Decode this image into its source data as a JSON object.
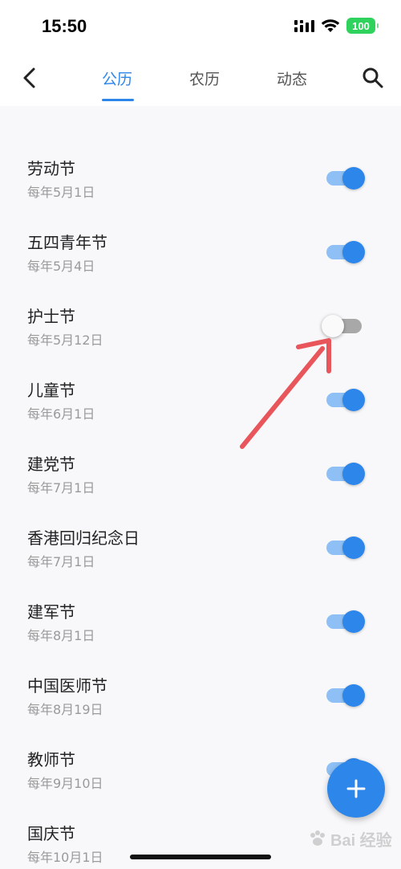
{
  "status_bar": {
    "time": "15:50",
    "battery": "100",
    "battery_color": "#2fd25c"
  },
  "nav": {
    "back_icon": "chevron-left-icon",
    "tabs": [
      {
        "label": "公历",
        "active": true
      },
      {
        "label": "农历",
        "active": false
      },
      {
        "label": "动态",
        "active": false
      }
    ],
    "search_icon": "search-icon",
    "accent_color": "#2d86e9"
  },
  "holidays": [
    {
      "title": "劳动节",
      "date": "每年5月1日",
      "enabled": true
    },
    {
      "title": "五四青年节",
      "date": "每年5月4日",
      "enabled": true
    },
    {
      "title": "护士节",
      "date": "每年5月12日",
      "enabled": false
    },
    {
      "title": "儿童节",
      "date": "每年6月1日",
      "enabled": true
    },
    {
      "title": "建党节",
      "date": "每年7月1日",
      "enabled": true
    },
    {
      "title": "香港回归纪念日",
      "date": "每年7月1日",
      "enabled": true
    },
    {
      "title": "建军节",
      "date": "每年8月1日",
      "enabled": true
    },
    {
      "title": "中国医师节",
      "date": "每年8月19日",
      "enabled": true
    },
    {
      "title": "教师节",
      "date": "每年9月10日",
      "enabled": true
    },
    {
      "title": "国庆节",
      "date": "每年10月1日",
      "enabled": true
    }
  ],
  "fab": {
    "icon": "plus-icon"
  },
  "watermark": "Bai 经验"
}
